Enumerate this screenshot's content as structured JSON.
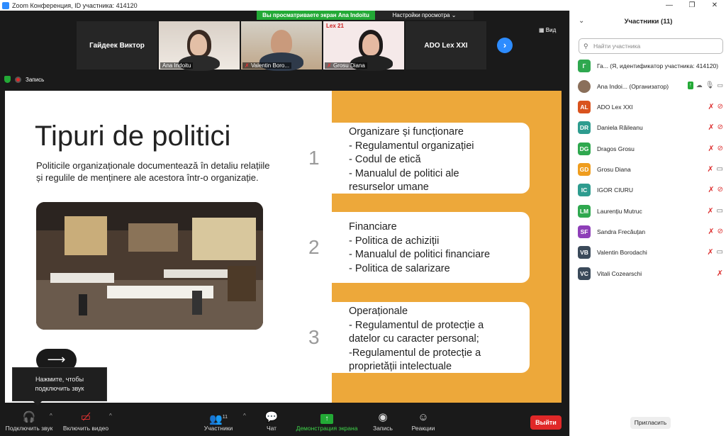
{
  "window": {
    "title": "Zoom Конференция, ID участника: 414120"
  },
  "banner": {
    "viewing": "Вы просматриваете экран Ana Indoitu",
    "view_settings": "Настройки просмотра ⌄"
  },
  "gallery": {
    "name_tile_left": "Гайдеек Виктор",
    "tiles": [
      {
        "name": "Ana Indoitu"
      },
      {
        "name": "Valentin Boro..."
      },
      {
        "name": "Grosu Diana"
      }
    ],
    "name_tile_right": "ADO Lex XXI",
    "view_label": "Вид",
    "lex_sign": "Lex 21"
  },
  "recording": {
    "label": "Запись"
  },
  "slide": {
    "title": "Tipuri de politici",
    "description": "Politicile organizaționale documentează în detaliu relațiile și regulile de menținere ale acestora într-o organizație.",
    "arrow": "⟶",
    "cards": [
      {
        "number": "1",
        "lines": [
          "Organizare și funcționare",
          "- Regulamentul organizației",
          "- Codul de etică",
          "- Manualul de politici ale",
          "resurselor umane"
        ]
      },
      {
        "number": "2",
        "lines": [
          "Financiare",
          "- Politica de achiziții",
          "- Manualul de politici financiare",
          "- Politica de salarizare"
        ]
      },
      {
        "number": "3",
        "lines": [
          "Operaționale",
          "- Regulamentul de protecție a",
          "datelor cu caracter personal;",
          "-Regulamentul de protecție a",
          "proprietății intelectuale"
        ]
      }
    ]
  },
  "tooltip": {
    "line1": "Нажмите, чтобы",
    "line2": "подключить звук"
  },
  "toolbar": {
    "audio": "Подключить звук",
    "video": "Включить видео",
    "participants": "Участники",
    "participants_count": "11",
    "chat": "Чат",
    "share": "Демонстрация экрана",
    "record": "Запись",
    "reactions": "Реакции",
    "exit": "Выйти"
  },
  "panel": {
    "title": "Участники (11)",
    "search_placeholder": "Найти участника",
    "invite": "Пригласить",
    "participants": [
      {
        "initials": "Г",
        "color": "#2fa84f",
        "name": "Га...  (Я, идентификатор участника: 414120)"
      },
      {
        "initials": "",
        "color": "#8a6f5a",
        "name": "Ana Indoi...  (Организатор)"
      },
      {
        "initials": "AL",
        "color": "#d9531e",
        "name": "ADO Lex XXI"
      },
      {
        "initials": "DR",
        "color": "#2e9c8f",
        "name": "Daniela Răileanu"
      },
      {
        "initials": "DG",
        "color": "#2fa84f",
        "name": "Dragos Grosu"
      },
      {
        "initials": "GD",
        "color": "#ef9d1f",
        "name": "Grosu Diana"
      },
      {
        "initials": "IC",
        "color": "#2e9c8f",
        "name": "IGOR CIURU"
      },
      {
        "initials": "LM",
        "color": "#2fa84f",
        "name": "Laurențiu Mutruc"
      },
      {
        "initials": "SF",
        "color": "#8e3fb8",
        "name": "Sandra Frecăuțan"
      },
      {
        "initials": "VB",
        "color": "#3b4a5a",
        "name": "Valentin Borodachi"
      },
      {
        "initials": "VC",
        "color": "#3b4a5a",
        "name": "Vitali Cozearschi"
      }
    ]
  }
}
